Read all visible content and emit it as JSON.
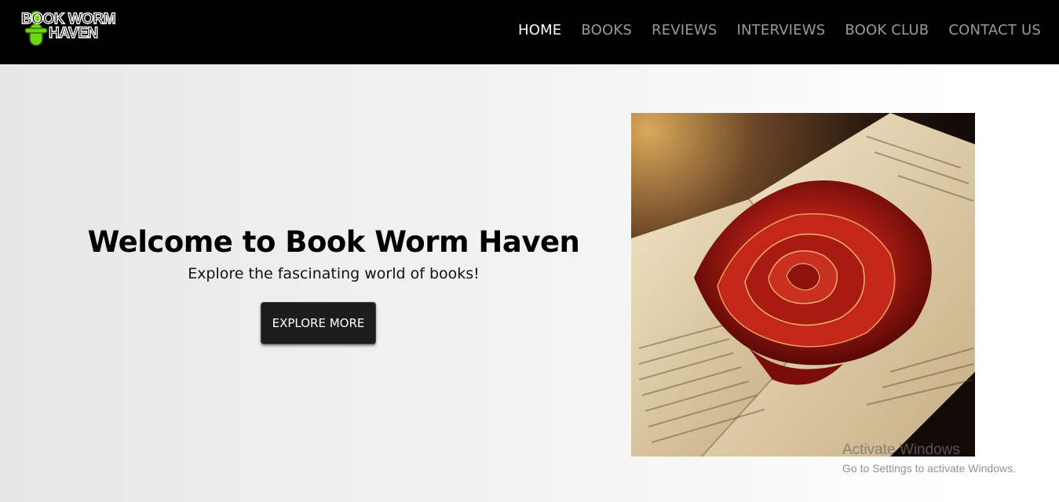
{
  "header": {
    "logo_text": "BOOK WORM HAVEN",
    "nav_items": [
      {
        "label": "HOME",
        "active": true
      },
      {
        "label": "BOOKS",
        "active": false
      },
      {
        "label": "REVIEWS",
        "active": false
      },
      {
        "label": "INTERVIEWS",
        "active": false
      },
      {
        "label": "BOOK CLUB",
        "active": false
      },
      {
        "label": "CONTACT US",
        "active": false
      }
    ]
  },
  "hero": {
    "title": "Welcome to Book Worm Haven",
    "subtitle": "Explore the fascinating world of books!",
    "button_label": "EXPLORE MORE",
    "image_icon": "rose-on-open-book-image"
  },
  "watermark": {
    "title": "Activate Windows",
    "subtitle": "Go to Settings to activate Windows."
  },
  "colors": {
    "header_bg": "#000000",
    "nav_active": "#ffffff",
    "nav_inactive": "#9a9a9a",
    "logo_accent": "#6fd614",
    "button_bg": "#1d1d1d"
  }
}
